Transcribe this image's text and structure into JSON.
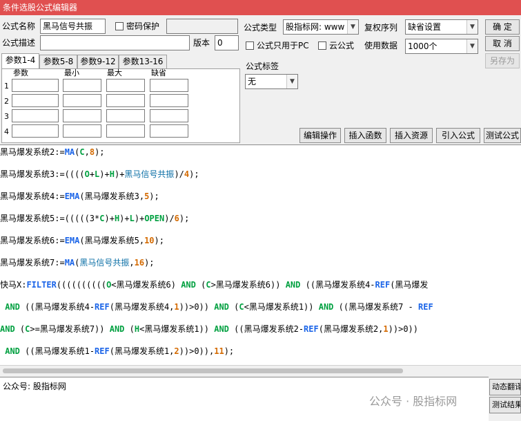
{
  "window": {
    "title": "条件选股公式编辑器"
  },
  "form": {
    "name_label": "公式名称",
    "name_value": "黑马信号共振",
    "password_label": "密码保护",
    "desc_label": "公式描述",
    "desc_value": "",
    "version_label": "版本",
    "version_value": "0",
    "type_label": "公式类型",
    "type_value": "股指标网: www",
    "only_pc_label": "公式只用于PC",
    "cloud_label": "云公式",
    "rights_label": "复权序列",
    "rights_value": "缺省设置",
    "data_label": "使用数据",
    "data_value": "1000个",
    "tag_label": "公式标签",
    "tag_value": "无"
  },
  "buttons": {
    "ok": "确  定",
    "cancel": "取  消",
    "save_as": "另存为",
    "edit_ops": "编辑操作",
    "insert_func": "插入函数",
    "insert_res": "插入资源",
    "import": "引入公式",
    "test": "测试公式"
  },
  "tabs": [
    "参数1-4",
    "参数5-8",
    "参数9-12",
    "参数13-16"
  ],
  "params": {
    "headers": [
      "参数",
      "最小",
      "最大",
      "缺省"
    ],
    "rows": [
      "1",
      "2",
      "3",
      "4"
    ]
  },
  "code_lines": [
    "黑马爆发系统2:=MA(C,8);",
    "黑马爆发系统3:=((((O+L)+H)+黑马信号共振)/4);",
    "黑马爆发系统4:=EMA(黑马爆发系统3,5);",
    "黑马爆发系统5:=(((((3*C)+H)+L)+OPEN)/6);",
    "黑马爆发系统6:=EMA(黑马爆发系统5,10);",
    "黑马爆发系统7:=MA(黑马信号共振,16);",
    "快马X:FILTER((((((((((O<黑马爆发系统6) AND (C>黑马爆发系统6)) AND ((黑马爆发系统4-REF(黑马爆发",
    " AND ((黑马爆发系统4-REF(黑马爆发系统4,1))>0)) AND (C<黑马爆发系统1)) AND ((黑马爆发系统7 - REF",
    "AND (C>=黑马爆发系统7)) AND (H<黑马爆发系统1)) AND ((黑马爆发系统2-REF(黑马爆发系统2,1))>0))",
    " AND ((黑马爆发系统1-REF(黑马爆发系统1,2))>0)),11);"
  ],
  "status": {
    "text": "公众号: 股指标网"
  },
  "side_buttons": [
    "动态翻译",
    "测试结果"
  ],
  "watermark": "公众号 · 股指标网",
  "colors": {
    "titlebar": "#e05050",
    "function": "#1a64e8",
    "number": "#d46a00",
    "operator": "#00a040"
  }
}
